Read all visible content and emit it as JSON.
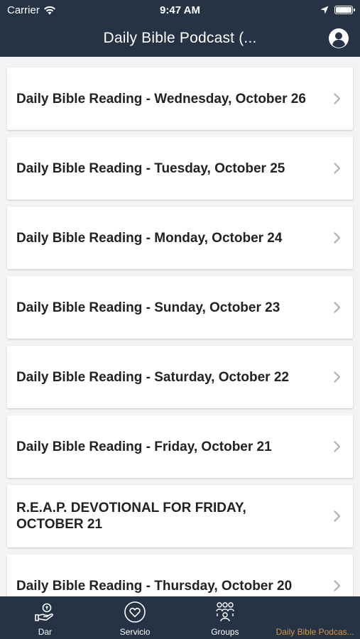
{
  "status_bar": {
    "carrier": "Carrier",
    "time": "9:47 AM"
  },
  "header": {
    "title": "Daily Bible Podcast (..."
  },
  "items": [
    {
      "title": "Daily Bible Reading - Wednesday, October 26"
    },
    {
      "title": "Daily Bible Reading - Tuesday, October 25"
    },
    {
      "title": "Daily Bible Reading - Monday, October 24"
    },
    {
      "title": "Daily Bible Reading - Sunday, October 23"
    },
    {
      "title": "Daily Bible Reading - Saturday, October 22"
    },
    {
      "title": "Daily Bible Reading - Friday, October 21"
    },
    {
      "title": "R.E.A.P. DEVOTIONAL FOR FRIDAY, OCTOBER 21"
    },
    {
      "title": "Daily Bible Reading - Thursday, October 20"
    }
  ],
  "tabs": [
    {
      "label": "Dar",
      "icon": "giving-hand-icon"
    },
    {
      "label": "Servicio",
      "icon": "heart-circle-icon"
    },
    {
      "label": "Groups",
      "icon": "groups-icon"
    },
    {
      "label": "Daily Bible Podcas...",
      "icon": "",
      "active": true
    }
  ],
  "colors": {
    "bar_background": "#253344",
    "active_tab": "#d99640",
    "page_background": "#f2f3f4"
  }
}
